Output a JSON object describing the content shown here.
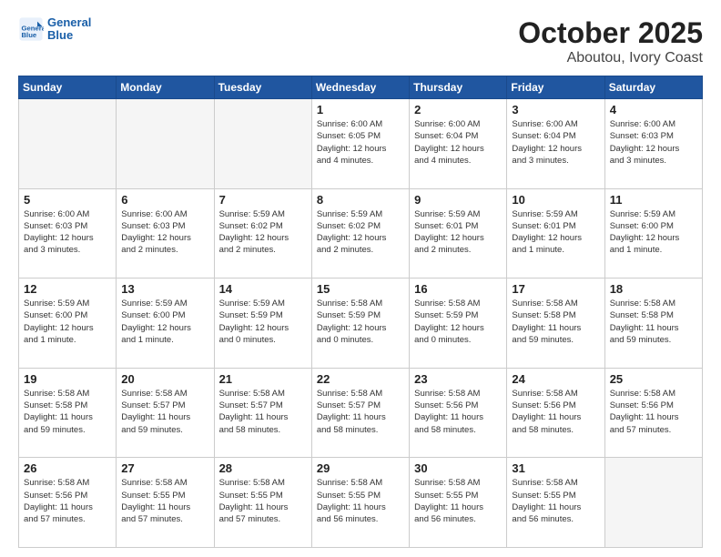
{
  "header": {
    "logo_general": "General",
    "logo_blue": "Blue",
    "title": "October 2025",
    "subtitle": "Aboutou, Ivory Coast"
  },
  "calendar": {
    "days_of_week": [
      "Sunday",
      "Monday",
      "Tuesday",
      "Wednesday",
      "Thursday",
      "Friday",
      "Saturday"
    ],
    "weeks": [
      [
        {
          "day": "",
          "info": ""
        },
        {
          "day": "",
          "info": ""
        },
        {
          "day": "",
          "info": ""
        },
        {
          "day": "1",
          "info": "Sunrise: 6:00 AM\nSunset: 6:05 PM\nDaylight: 12 hours\nand 4 minutes."
        },
        {
          "day": "2",
          "info": "Sunrise: 6:00 AM\nSunset: 6:04 PM\nDaylight: 12 hours\nand 4 minutes."
        },
        {
          "day": "3",
          "info": "Sunrise: 6:00 AM\nSunset: 6:04 PM\nDaylight: 12 hours\nand 3 minutes."
        },
        {
          "day": "4",
          "info": "Sunrise: 6:00 AM\nSunset: 6:03 PM\nDaylight: 12 hours\nand 3 minutes."
        }
      ],
      [
        {
          "day": "5",
          "info": "Sunrise: 6:00 AM\nSunset: 6:03 PM\nDaylight: 12 hours\nand 3 minutes."
        },
        {
          "day": "6",
          "info": "Sunrise: 6:00 AM\nSunset: 6:03 PM\nDaylight: 12 hours\nand 2 minutes."
        },
        {
          "day": "7",
          "info": "Sunrise: 5:59 AM\nSunset: 6:02 PM\nDaylight: 12 hours\nand 2 minutes."
        },
        {
          "day": "8",
          "info": "Sunrise: 5:59 AM\nSunset: 6:02 PM\nDaylight: 12 hours\nand 2 minutes."
        },
        {
          "day": "9",
          "info": "Sunrise: 5:59 AM\nSunset: 6:01 PM\nDaylight: 12 hours\nand 2 minutes."
        },
        {
          "day": "10",
          "info": "Sunrise: 5:59 AM\nSunset: 6:01 PM\nDaylight: 12 hours\nand 1 minute."
        },
        {
          "day": "11",
          "info": "Sunrise: 5:59 AM\nSunset: 6:00 PM\nDaylight: 12 hours\nand 1 minute."
        }
      ],
      [
        {
          "day": "12",
          "info": "Sunrise: 5:59 AM\nSunset: 6:00 PM\nDaylight: 12 hours\nand 1 minute."
        },
        {
          "day": "13",
          "info": "Sunrise: 5:59 AM\nSunset: 6:00 PM\nDaylight: 12 hours\nand 1 minute."
        },
        {
          "day": "14",
          "info": "Sunrise: 5:59 AM\nSunset: 5:59 PM\nDaylight: 12 hours\nand 0 minutes."
        },
        {
          "day": "15",
          "info": "Sunrise: 5:58 AM\nSunset: 5:59 PM\nDaylight: 12 hours\nand 0 minutes."
        },
        {
          "day": "16",
          "info": "Sunrise: 5:58 AM\nSunset: 5:59 PM\nDaylight: 12 hours\nand 0 minutes."
        },
        {
          "day": "17",
          "info": "Sunrise: 5:58 AM\nSunset: 5:58 PM\nDaylight: 11 hours\nand 59 minutes."
        },
        {
          "day": "18",
          "info": "Sunrise: 5:58 AM\nSunset: 5:58 PM\nDaylight: 11 hours\nand 59 minutes."
        }
      ],
      [
        {
          "day": "19",
          "info": "Sunrise: 5:58 AM\nSunset: 5:58 PM\nDaylight: 11 hours\nand 59 minutes."
        },
        {
          "day": "20",
          "info": "Sunrise: 5:58 AM\nSunset: 5:57 PM\nDaylight: 11 hours\nand 59 minutes."
        },
        {
          "day": "21",
          "info": "Sunrise: 5:58 AM\nSunset: 5:57 PM\nDaylight: 11 hours\nand 58 minutes."
        },
        {
          "day": "22",
          "info": "Sunrise: 5:58 AM\nSunset: 5:57 PM\nDaylight: 11 hours\nand 58 minutes."
        },
        {
          "day": "23",
          "info": "Sunrise: 5:58 AM\nSunset: 5:56 PM\nDaylight: 11 hours\nand 58 minutes."
        },
        {
          "day": "24",
          "info": "Sunrise: 5:58 AM\nSunset: 5:56 PM\nDaylight: 11 hours\nand 58 minutes."
        },
        {
          "day": "25",
          "info": "Sunrise: 5:58 AM\nSunset: 5:56 PM\nDaylight: 11 hours\nand 57 minutes."
        }
      ],
      [
        {
          "day": "26",
          "info": "Sunrise: 5:58 AM\nSunset: 5:56 PM\nDaylight: 11 hours\nand 57 minutes."
        },
        {
          "day": "27",
          "info": "Sunrise: 5:58 AM\nSunset: 5:55 PM\nDaylight: 11 hours\nand 57 minutes."
        },
        {
          "day": "28",
          "info": "Sunrise: 5:58 AM\nSunset: 5:55 PM\nDaylight: 11 hours\nand 57 minutes."
        },
        {
          "day": "29",
          "info": "Sunrise: 5:58 AM\nSunset: 5:55 PM\nDaylight: 11 hours\nand 56 minutes."
        },
        {
          "day": "30",
          "info": "Sunrise: 5:58 AM\nSunset: 5:55 PM\nDaylight: 11 hours\nand 56 minutes."
        },
        {
          "day": "31",
          "info": "Sunrise: 5:58 AM\nSunset: 5:55 PM\nDaylight: 11 hours\nand 56 minutes."
        },
        {
          "day": "",
          "info": ""
        }
      ]
    ]
  }
}
